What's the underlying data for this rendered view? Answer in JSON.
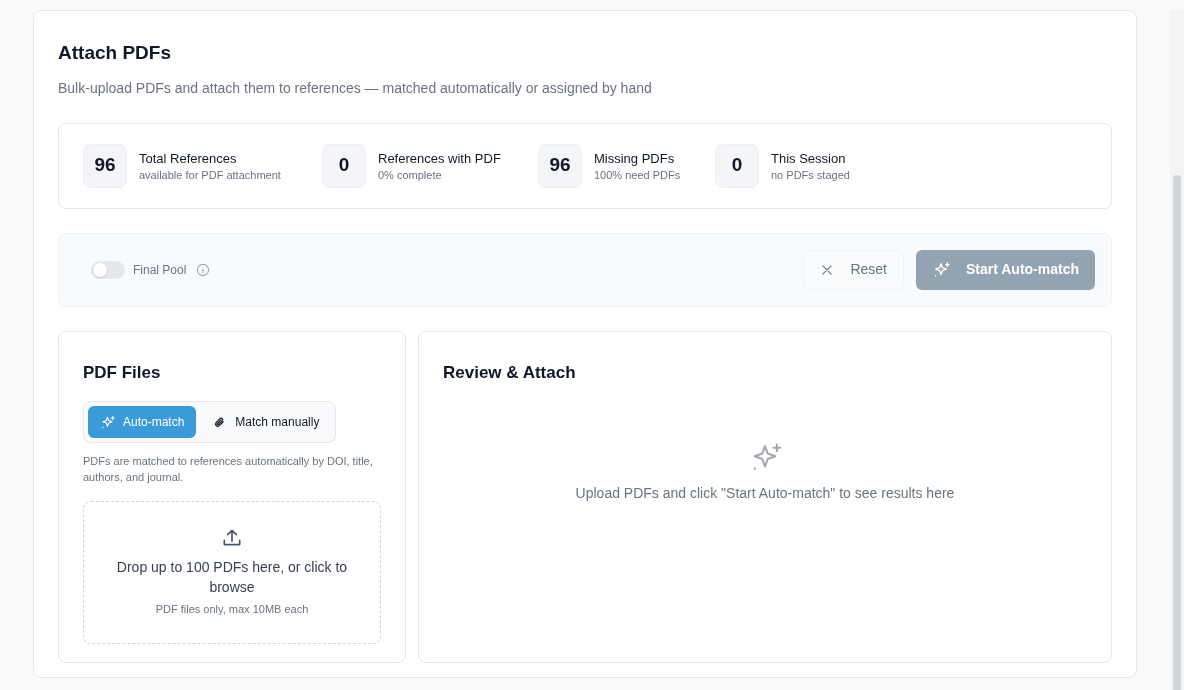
{
  "title": "Attach PDFs",
  "subtitle": "Bulk-upload PDFs and attach them to references — matched automatically or assigned by hand",
  "stats": [
    {
      "value": "96",
      "label": "Total References",
      "caption": "available for PDF attachment"
    },
    {
      "value": "0",
      "label": "References with PDF",
      "caption": "0% complete"
    },
    {
      "value": "96",
      "label": "Missing PDFs",
      "caption": "100% need PDFs"
    },
    {
      "value": "0",
      "label": "This Session",
      "caption": "no PDFs staged"
    }
  ],
  "toolbar": {
    "toggle": {
      "label": "Final Pool",
      "on": false
    },
    "reset": {
      "label": "Reset"
    },
    "start": {
      "label": "Start Auto-match",
      "disabled": true
    }
  },
  "pdf_files": {
    "title": "PDF Files",
    "modes": [
      {
        "label": "Auto-match",
        "kind": "sparkle",
        "selected": true
      },
      {
        "label": "Match manually",
        "kind": "clip",
        "selected": false
      }
    ],
    "help": "PDFs are matched to references automatically by DOI, title, authors, and journal.",
    "dropzone": {
      "text": "Drop up to 100 PDFs here, or click to browse",
      "hint": "PDF files only, max 10MB each"
    }
  },
  "review": {
    "title": "Review & Attach",
    "empty": "Upload PDFs and click \"Start Auto-match\" to see results here"
  }
}
